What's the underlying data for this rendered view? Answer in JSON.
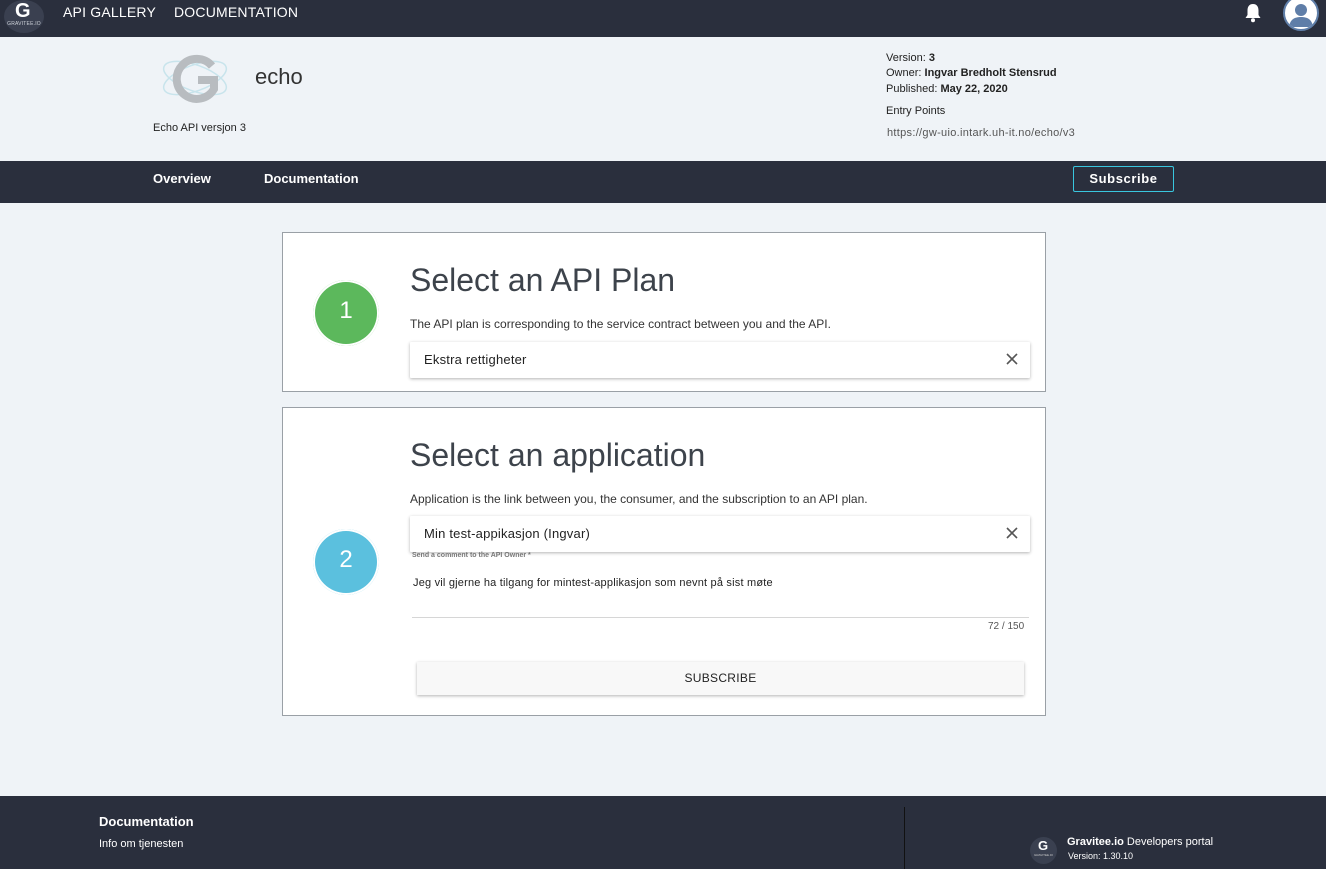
{
  "topbar": {
    "logo_text": "GRAVITEE.IO",
    "nav": [
      "API GALLERY",
      "DOCUMENTATION"
    ]
  },
  "api": {
    "name": "echo",
    "description": "Echo API versjon 3",
    "version_label": "Version:",
    "version": "3",
    "owner_label": "Owner:",
    "owner": "Ingvar Bredholt Stensrud",
    "published_label": "Published:",
    "published": "May 22, 2020",
    "entry_points_label": "Entry Points",
    "entry_point": "https://gw-uio.intark.uh-it.no/echo/v3"
  },
  "subnav": {
    "overview": "Overview",
    "documentation": "Documentation",
    "subscribe": "Subscribe"
  },
  "plan_step": {
    "number": "1",
    "title": "Select an API Plan",
    "subtitle": "The API plan is corresponding to the service contract between you and the API.",
    "selected": "Ekstra rettigheter",
    "color": "#5cb85c"
  },
  "app_step": {
    "number": "2",
    "title": "Select an application",
    "subtitle": "Application is the link between you, the consumer, and the subscription to an API plan.",
    "selected": "Min test-appikasjon (Ingvar)",
    "comment_label": "Send a comment to the API Owner *",
    "comment": "Jeg vil gjerne ha tilgang for mintest-applikasjon som nevnt på sist møte",
    "counter": "72 / 150",
    "subscribe_button": "SUBSCRIBE",
    "color": "#5bc0de"
  },
  "footer": {
    "title": "Documentation",
    "link": "Info om tjenesten",
    "brand": "Gravitee.io",
    "portal": " Developers portal",
    "version": "Version: 1.30.10",
    "logo_text": "GRAVITEE.IO"
  }
}
